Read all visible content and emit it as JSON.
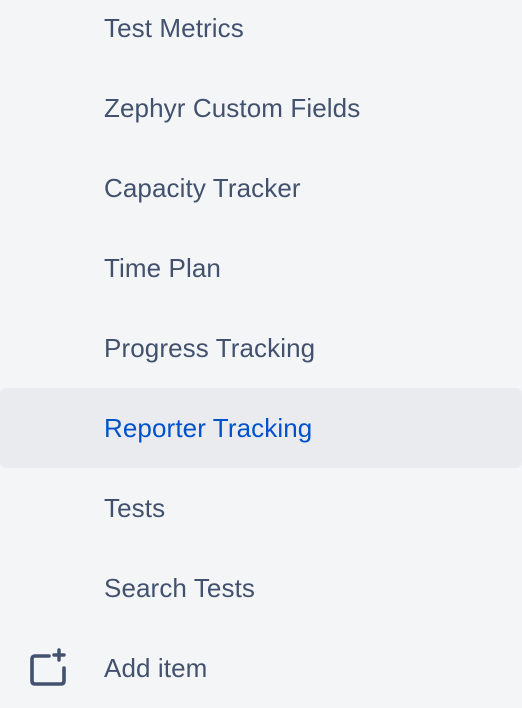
{
  "sidebar": {
    "items": [
      {
        "label": "Test Metrics"
      },
      {
        "label": "Zephyr Custom Fields"
      },
      {
        "label": "Capacity Tracker"
      },
      {
        "label": "Time Plan"
      },
      {
        "label": "Progress Tracking"
      },
      {
        "label": "Reporter Tracking",
        "active": true
      },
      {
        "label": "Tests"
      },
      {
        "label": "Search Tests"
      }
    ],
    "add_item": {
      "label": "Add item",
      "icon": "add-item-icon"
    },
    "colors": {
      "background": "#f4f5f7",
      "text": "#42526e",
      "active_text": "#0052cc",
      "active_background": "#e9ebef"
    }
  }
}
